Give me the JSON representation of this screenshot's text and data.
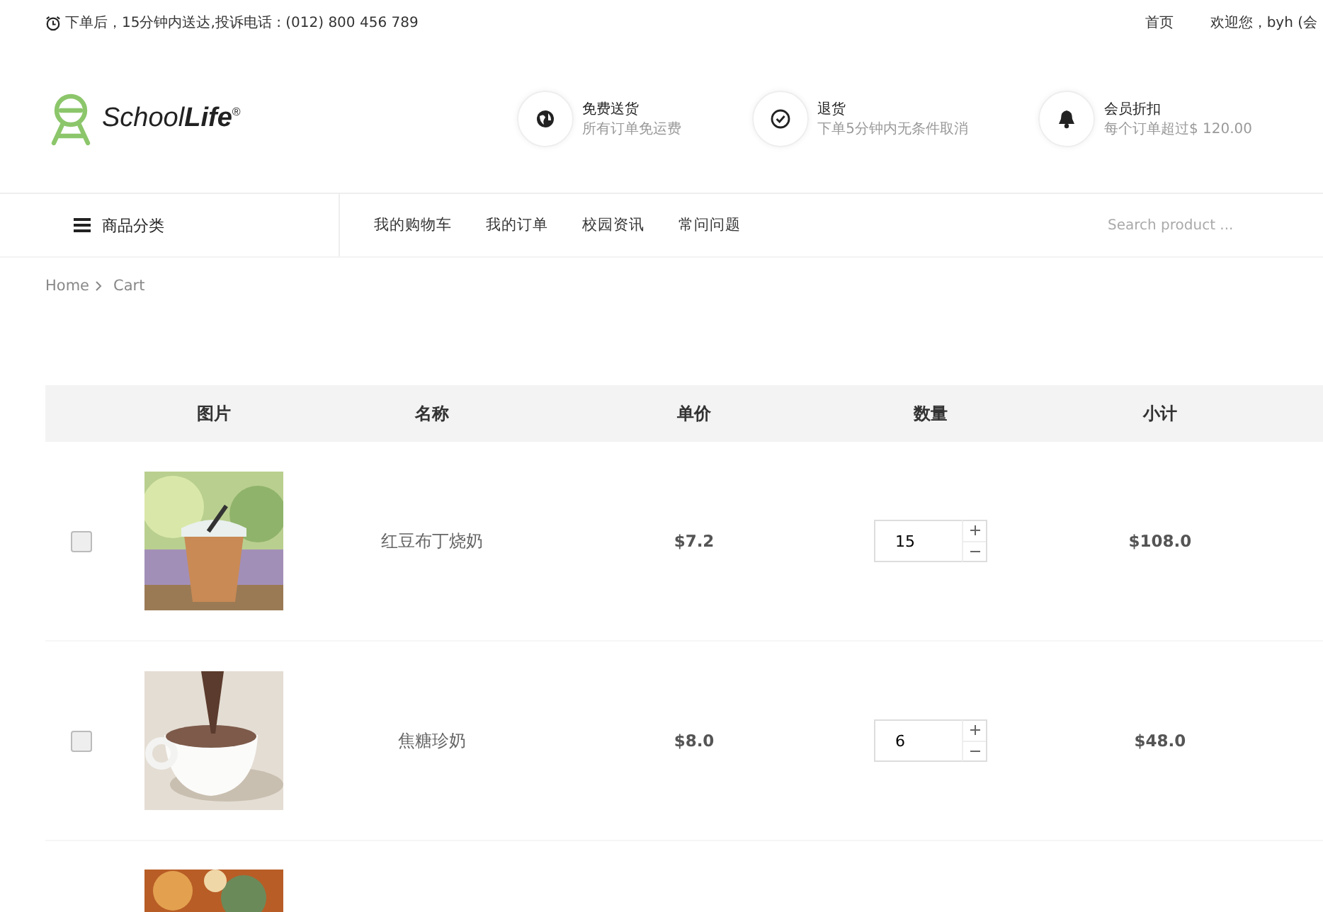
{
  "top_bar": {
    "notice": "下单后，15分钟内送达,投诉电话 : (012) 800 456 789",
    "links": [
      "首页",
      "欢迎您，byh (会"
    ]
  },
  "header": {
    "logo": "School**Life**$^{®}$",
    "features": [
      {
        "kind": "globe",
        "title": "免费送货",
        "subtitle": "所有订单免运费"
      },
      {
        "kind": "check",
        "title": "退货",
        "subtitle": "下单5分钟内无条件取消"
      },
      {
        "kind": "bell",
        "title": "会员折扣",
        "subtitle": "每个订单超过$ 120.00"
      }
    ]
  },
  "nav": {
    "category": "商品分类",
    "items": [
      "我的购物车",
      "我的订单",
      "校园资讯",
      "常问问题"
    ],
    "search": {
      "placeholder": "Search product ..."
    }
  },
  "breadcrumb": [
    "Home",
    "Cart"
  ],
  "table": {
    "columns": [
      "图片",
      "名称",
      "单价",
      "数量",
      "小计"
    ],
    "rows": [
      {
        "checked": false,
        "image": {
          "kind": "picture"
        },
        "name": "红豆布丁烧奶",
        "price": "$7.2",
        "quantity": "15",
        "subtotal": "$108.0"
      },
      {
        "checked": false,
        "image": {
          "kind": "picture"
        },
        "name": "焦糖珍奶",
        "price": "$8.0",
        "quantity": "6",
        "subtotal": "$48.0"
      },
      {
        "image": {
          "kind": "picture"
        }
      }
    ]
  }
}
